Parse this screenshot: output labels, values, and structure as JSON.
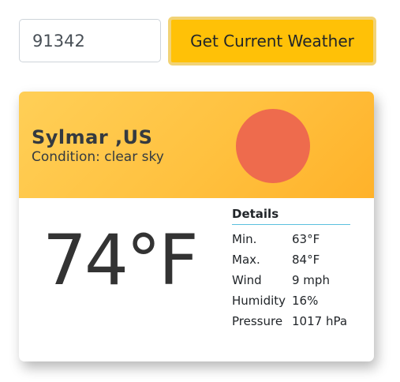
{
  "search": {
    "zip_value": "91342",
    "button_label": "Get Current Weather"
  },
  "weather": {
    "city": "Sylmar ,US",
    "condition_label": "Condition:",
    "condition_value": "clear sky",
    "icon": "sun-icon",
    "icon_color": "#ee6b4d",
    "temperature": "74°F",
    "details_title": "Details",
    "details": [
      {
        "label": "Min.",
        "value": "63°F"
      },
      {
        "label": "Max.",
        "value": "84°F"
      },
      {
        "label": "Wind",
        "value": "9 mph"
      },
      {
        "label": "Humidity",
        "value": "16%"
      },
      {
        "label": "Pressure",
        "value": "1017 hPa"
      }
    ]
  },
  "colors": {
    "button_bg": "#ffc107",
    "header_gradient_start": "#ffcf57",
    "header_gradient_end": "#ffb22a",
    "divider": "#5bc0de"
  }
}
